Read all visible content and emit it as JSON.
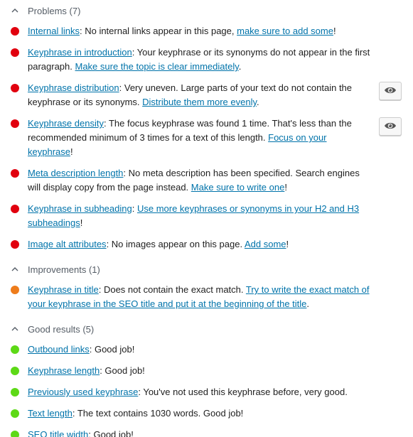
{
  "colors": {
    "bad": "#e1000e",
    "ok": "#ee7c1b",
    "good": "#5dd916",
    "link": "#0073aa"
  },
  "sections": [
    {
      "title": "Problems (7)",
      "items": [
        {
          "status": "bad",
          "link": "Internal links",
          "text": ": No internal links appear in this page, ",
          "action": "make sure to add some",
          "tail": "!",
          "eye": false
        },
        {
          "status": "bad",
          "link": "Keyphrase in introduction",
          "text": ": Your keyphrase or its synonyms do not appear in the first paragraph. ",
          "action": "Make sure the topic is clear immediately",
          "tail": ".",
          "eye": false
        },
        {
          "status": "bad",
          "link": "Keyphrase distribution",
          "text": ": Very uneven. Large parts of your text do not contain the keyphrase or its synonyms. ",
          "action": "Distribute them more evenly",
          "tail": ".",
          "eye": true
        },
        {
          "status": "bad",
          "link": "Keyphrase density",
          "text": ": The focus keyphrase was found 1 time. That's less than the recommended minimum of 3 times for a text of this length. ",
          "action": "Focus on your keyphrase",
          "tail": "!",
          "eye": true
        },
        {
          "status": "bad",
          "link": "Meta description length",
          "text": ": No meta description has been specified. Search engines will display copy from the page instead. ",
          "action": "Make sure to write one",
          "tail": "!",
          "eye": false
        },
        {
          "status": "bad",
          "link": "Keyphrase in subheading",
          "text": ": ",
          "action": "Use more keyphrases or synonyms in your H2 and H3 subheadings",
          "tail": "!",
          "eye": false
        },
        {
          "status": "bad",
          "link": "Image alt attributes",
          "text": ": No images appear on this page. ",
          "action": "Add some",
          "tail": "!",
          "eye": false
        }
      ]
    },
    {
      "title": "Improvements (1)",
      "items": [
        {
          "status": "ok",
          "link": "Keyphrase in title",
          "text": ": Does not contain the exact match. ",
          "action": "Try to write the exact match of your keyphrase in the SEO title and put it at the beginning of the title",
          "tail": ".",
          "eye": false
        }
      ]
    },
    {
      "title": "Good results (5)",
      "items": [
        {
          "status": "good",
          "link": "Outbound links",
          "text": ": Good job!",
          "action": "",
          "tail": "",
          "eye": false
        },
        {
          "status": "good",
          "link": "Keyphrase length",
          "text": ": Good job!",
          "action": "",
          "tail": "",
          "eye": false
        },
        {
          "status": "good",
          "link": "Previously used keyphrase",
          "text": ": You've not used this keyphrase before, very good.",
          "action": "",
          "tail": "",
          "eye": false
        },
        {
          "status": "good",
          "link": "Text length",
          "text": ": The text contains 1030 words. Good job!",
          "action": "",
          "tail": "",
          "eye": false
        },
        {
          "status": "good",
          "link": "SEO title width",
          "text": ": Good job!",
          "action": "",
          "tail": "",
          "eye": false
        }
      ]
    }
  ],
  "icons": {
    "collapse": "chevron-up-icon",
    "highlight": "eye-icon"
  }
}
